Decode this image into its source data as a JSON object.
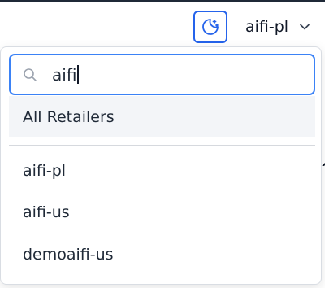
{
  "header": {
    "theme_toggle_icon": "moon-stars-icon",
    "selected_retailer": "aifi-pl",
    "chevron_icon": "chevron-down-icon"
  },
  "dropdown": {
    "search": {
      "value": "aifi",
      "icon": "search-icon"
    },
    "all_option": "All Retailers",
    "options": [
      "aifi-pl",
      "aifi-us",
      "demoaifi-us"
    ]
  },
  "colors": {
    "accent": "#2563eb",
    "focus_border": "#3b82f6",
    "option_highlight": "#f3f5f8"
  }
}
